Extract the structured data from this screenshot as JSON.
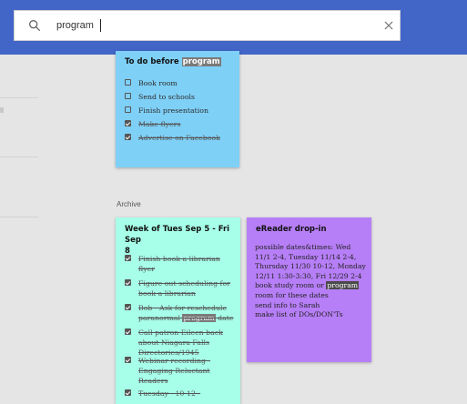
{
  "search": {
    "value": "program",
    "icons": {
      "search": "search-icon",
      "clear": "close-icon"
    }
  },
  "colors": {
    "header": "#4265c8",
    "note_blue": "#7fd0f7",
    "note_teal": "#a7ffe9",
    "note_purple": "#b77ff7"
  },
  "note1": {
    "title_pre": "To do before ",
    "title_hl": "program",
    "items": [
      {
        "text": "Book room",
        "checked": false
      },
      {
        "text": "Send to schools",
        "checked": false
      },
      {
        "text": "Finish presentation",
        "checked": false
      },
      {
        "text": "Make flyers",
        "checked": true
      },
      {
        "text": "Advertise on Facebook",
        "checked": true
      }
    ]
  },
  "archive_label": "Archive",
  "note2": {
    "title_line1": "Week of Tues Sep 5 - Fri Sep",
    "title_line2": "8",
    "items": [
      {
        "text": "Finish book a librarian flyer",
        "checked": true
      },
      {
        "text": "Figure out scheduling for book a librarian",
        "checked": true
      },
      {
        "text_pre": "Bob - Ask for reschedule paranormal ",
        "text_hl": "program",
        "text_post": " date",
        "checked": true
      },
      {
        "text": "Call patron Eileen back about Niagara Falls Directories/1945",
        "checked": true
      },
      {
        "text": "Webinar recording - Engaging Reluctant Readers",
        "checked": true
      },
      {
        "text": "Tuesday - 10-12 -",
        "checked": true
      }
    ]
  },
  "note3": {
    "title": "eReader drop-in",
    "body_pre": "possible dates&times: Wed 11/1 2-4, Tuesday 11/14 2-4, Thursday 11/30 10-12, Monday 12/11 1:30-3:30, Fri 12/29 2-4 book study room or ",
    "body_hl": "program",
    "body_post": " room for these dates",
    "line2": "send info to Sarah",
    "line3": "make list of DOs/DON'Ts"
  }
}
